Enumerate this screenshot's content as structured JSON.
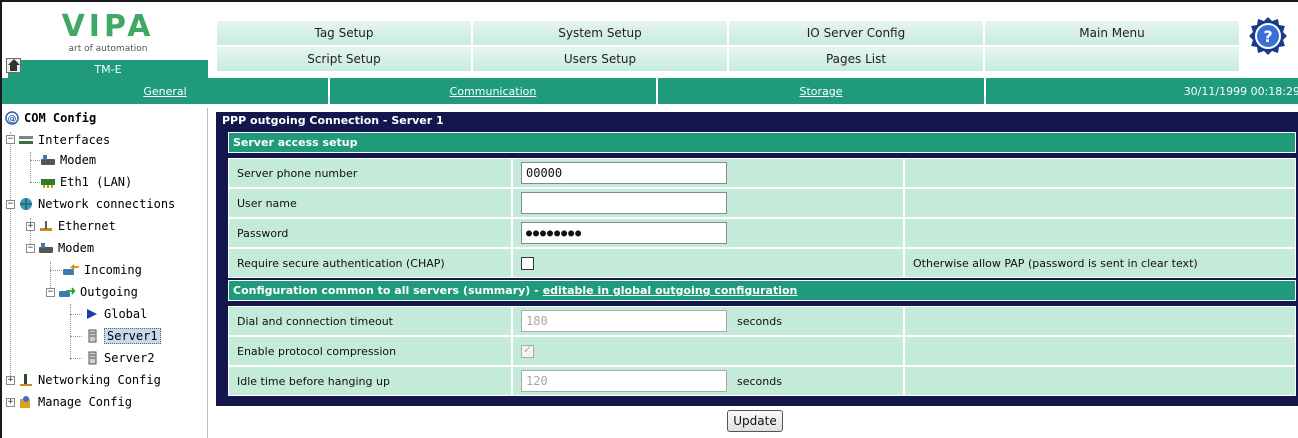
{
  "header": {
    "logo_text": "VIPA",
    "logo_tagline": "art of automation",
    "device_name": "TM-E",
    "menu": [
      {
        "label": "Tag Setup"
      },
      {
        "label": "System Setup"
      },
      {
        "label": "IO Server Config"
      },
      {
        "label": "Main Menu"
      },
      {
        "label": "Script Setup"
      },
      {
        "label": "Users Setup"
      },
      {
        "label": "Pages List"
      },
      {
        "label": ""
      }
    ],
    "help_icon": "help-icon"
  },
  "subnav": {
    "tabs": [
      {
        "label": "General"
      },
      {
        "label": "Communication"
      },
      {
        "label": "Storage"
      }
    ],
    "datetime": "30/11/1999 00:18:29"
  },
  "sidebar": {
    "root_label": "COM Config",
    "items": [
      {
        "label": "Interfaces",
        "icon": "interfaces-icon"
      },
      {
        "label": "Modem",
        "icon": "modem-icon"
      },
      {
        "label": "Eth1 (LAN)",
        "icon": "lan-card-icon"
      },
      {
        "label": "Network connections",
        "icon": "network-icon"
      },
      {
        "label": "Ethernet",
        "icon": "ethernet-icon"
      },
      {
        "label": "Modem",
        "icon": "modem-icon"
      },
      {
        "label": "Incoming",
        "icon": "incoming-icon"
      },
      {
        "label": "Outgoing",
        "icon": "outgoing-icon"
      },
      {
        "label": "Global",
        "icon": "arrow-right-icon"
      },
      {
        "label": "Server1",
        "icon": "server-icon"
      },
      {
        "label": "Server2",
        "icon": "server-icon"
      },
      {
        "label": "Networking Config",
        "icon": "networking-config-icon"
      },
      {
        "label": "Manage Config",
        "icon": "manage-config-icon"
      }
    ]
  },
  "panel": {
    "title": "PPP outgoing Connection - Server 1",
    "section1_title": "Server access setup",
    "section2_title": "Configuration common to all servers (summary) -",
    "section2_link": "editable in global outgoing configuration",
    "rows": [
      {
        "label": "Server phone number",
        "value": "00000",
        "note": ""
      },
      {
        "label": "User name",
        "value": "",
        "note": ""
      },
      {
        "label": "Password",
        "value": "●●●●●●●●",
        "note": ""
      },
      {
        "label": "Require secure authentication (CHAP)",
        "value": "",
        "note": "Otherwise allow PAP (password is sent in clear text)"
      },
      {
        "label": "Dial and connection timeout",
        "value": "180",
        "unit": "seconds"
      },
      {
        "label": "Enable protocol compression",
        "value": ""
      },
      {
        "label": "Idle time before hanging up",
        "value": "120",
        "unit": "seconds"
      }
    ],
    "update_label": "Update"
  },
  "colors": {
    "accent_teal": "#1f9a7a",
    "panel_navy": "#14174d",
    "row_mint": "#c4eada",
    "logo_green": "#3fa864"
  }
}
